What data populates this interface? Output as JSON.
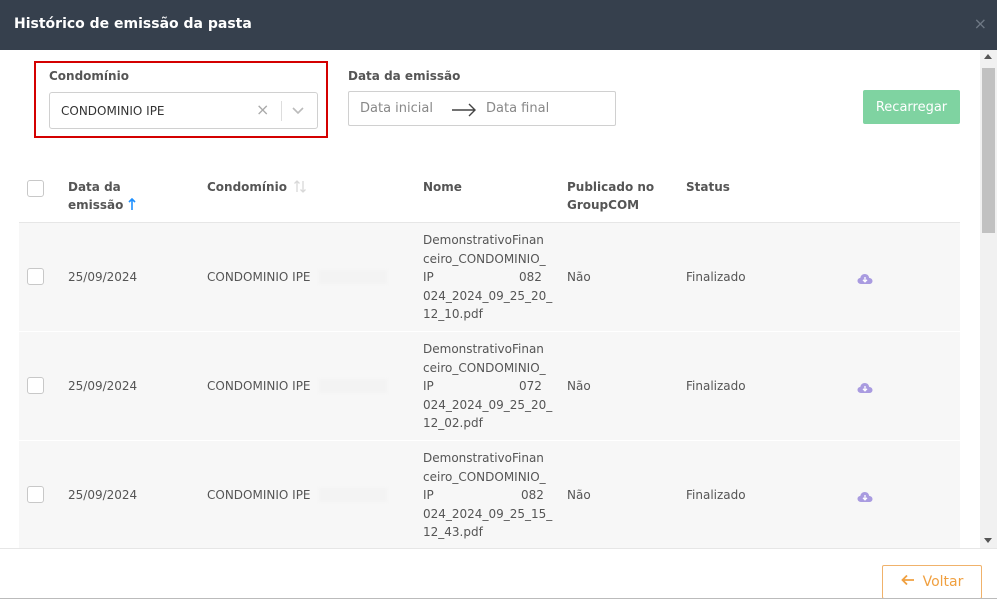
{
  "modal": {
    "title": "Histórico de emissão da pasta",
    "close": "×"
  },
  "filters": {
    "condo_label": "Condomínio",
    "condo_value": "CONDOMINIO IPE",
    "date_label": "Data da emissão",
    "date_start_placeholder": "Data inicial",
    "date_end_placeholder": "Data final",
    "reload_label": "Recarregar"
  },
  "table": {
    "headers": {
      "date_line1": "Data da",
      "date_line2": "emissão",
      "condo": "Condomínio",
      "name": "Nome",
      "published_line1": "Publicado no",
      "published_line2": "GroupCOM",
      "status": "Status"
    },
    "rows": [
      {
        "date": "25/09/2024",
        "condo": "CONDOMINIO IPE",
        "name_lines": [
          "DemonstrativoFinan",
          "ceiro_CONDOMINIO_",
          "IP",
          "024_2024_09_25_20_",
          "12_10.pdf"
        ],
        "name_suffix": "082",
        "published": "Não",
        "status": "Finalizado"
      },
      {
        "date": "25/09/2024",
        "condo": "CONDOMINIO IPE",
        "name_lines": [
          "DemonstrativoFinan",
          "ceiro_CONDOMINIO_",
          "IP",
          "024_2024_09_25_20_",
          "12_02.pdf"
        ],
        "name_suffix": "072",
        "published": "Não",
        "status": "Finalizado"
      },
      {
        "date": "25/09/2024",
        "condo": "CONDOMINIO IPE",
        "name_lines": [
          "DemonstrativoFinan",
          "ceiro_CONDOMINIO_",
          "IP",
          "024_2024_09_25_15_",
          "12_43.pdf"
        ],
        "name_suffix": "082",
        "published": "Não",
        "status": "Finalizado"
      }
    ]
  },
  "footer": {
    "back_label": "Voltar"
  },
  "colors": {
    "header_bg": "#36404d",
    "reload_bg": "#7fd3a1",
    "back_accent": "#f0a040",
    "highlight": "#d40000",
    "sort_active": "#1e90ff",
    "cloud_icon": "#a99be0"
  },
  "icons": [
    "close-icon",
    "clear-icon",
    "chevron-down-icon",
    "arrow-right-icon",
    "sort-asc-icon",
    "sort-icon",
    "cloud-download-icon",
    "arrow-left-icon"
  ]
}
